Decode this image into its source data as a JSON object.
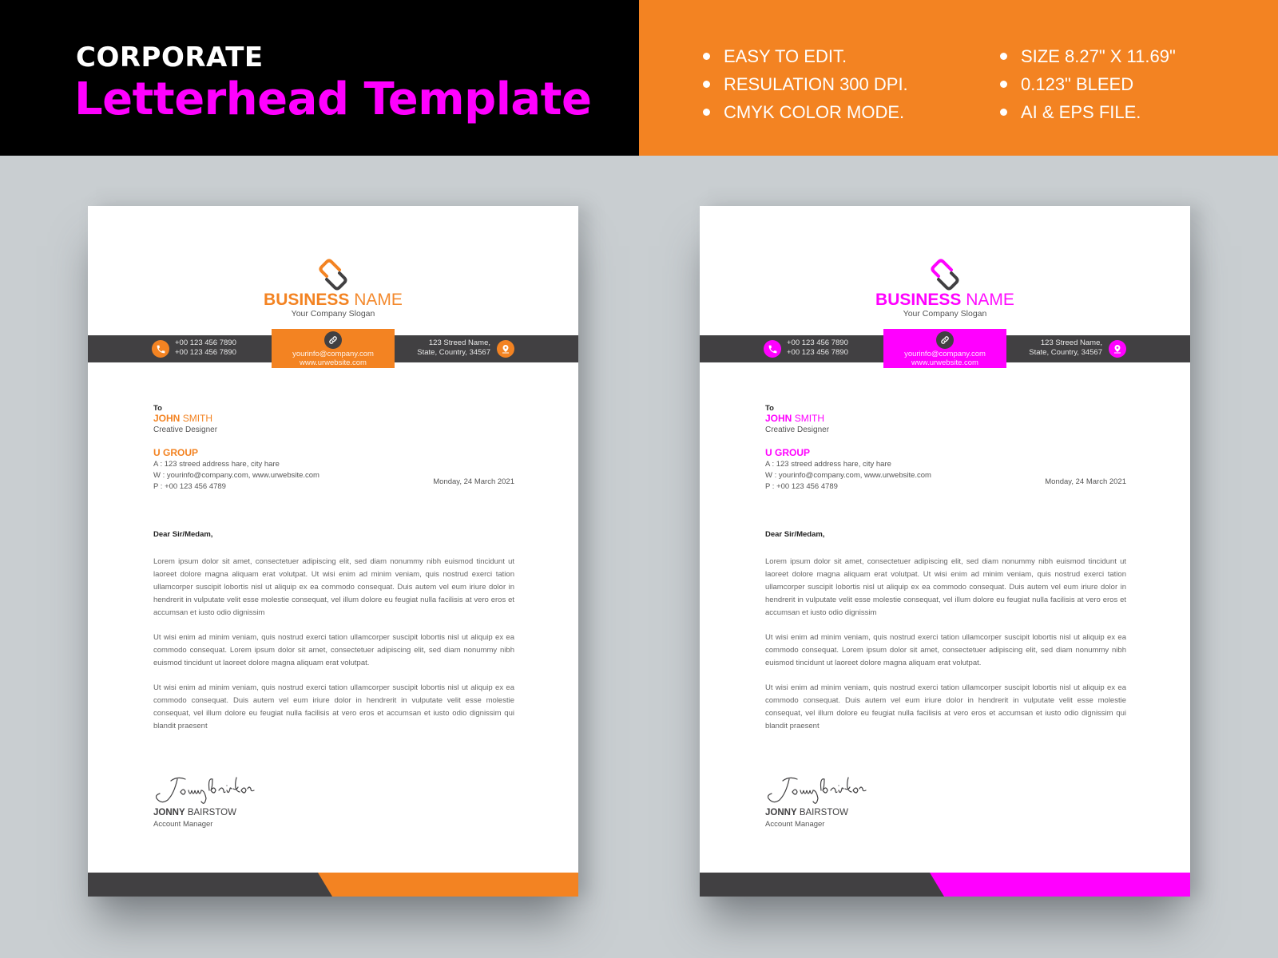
{
  "banner": {
    "title_small": "CORPORATE",
    "title_big": "Letterhead Template",
    "features_col1": [
      "EASY TO EDIT.",
      "RESULATION 300 DPI.",
      "CMYK COLOR MODE."
    ],
    "features_col2": [
      "SIZE 8.27\" X 11.69\"",
      "0.123\" BLEED",
      "AI & EPS FILE."
    ],
    "colors": {
      "left_bg": "#000000",
      "right_bg": "#f38322",
      "title_big": "#ff00ff"
    }
  },
  "letters": [
    {
      "accent": "#f38322",
      "business_bold": "BUSINESS",
      "business_light": "NAME",
      "slogan": "Your Company Slogan",
      "phone_1": "+00 123 456 7890",
      "phone_2": "+00 123 456 7890",
      "email": "yourinfo@company.com",
      "website": "www.urwebsite.com",
      "address_1": "123 Streed Name,",
      "address_2": "State, Country, 34567",
      "to_label": "To",
      "recipient_first": "JOHN",
      "recipient_last": "SMITH",
      "recipient_role": "Creative Designer",
      "company": "U GROUP",
      "company_address": "A  : 123 streed address hare, city hare",
      "company_web": "W : yourinfo@company.com, www.urwebsite.com",
      "company_phone": "P  : +00 123 456 4789",
      "date": "Monday, 24 March 2021",
      "salutation": "Dear Sir/Medam,",
      "paragraphs": [
        "Lorem ipsum dolor sit amet, consectetuer adipiscing elit, sed diam nonummy nibh euismod tincidunt ut laoreet dolore magna aliquam erat volutpat. Ut wisi enim ad minim veniam, quis nostrud exerci tation ullamcorper suscipit lobortis nisl ut aliquip ex ea commodo consequat. Duis autem vel eum iriure dolor in hendrerit in vulputate velit esse molestie consequat, vel illum dolore eu feugiat nulla facilisis at vero eros et accumsan et iusto odio dignissim",
        "Ut wisi enim ad minim veniam, quis nostrud exerci tation ullamcorper suscipit lobortis nisl ut aliquip ex ea commodo consequat. Lorem ipsum dolor sit amet, consectetuer adipiscing elit, sed diam nonummy nibh euismod tincidunt ut laoreet dolore magna aliquam erat volutpat.",
        "Ut wisi enim ad minim veniam, quis nostrud exerci tation ullamcorper suscipit lobortis nisl ut aliquip ex ea commodo consequat. Duis autem vel eum iriure dolor in hendrerit in vulputate velit esse molestie consequat, vel illum dolore eu feugiat nulla facilisis at vero eros et accumsan et iusto odio dignissim qui blandit praesent"
      ],
      "signature": "Jonnybairyton",
      "signer_first": "JONNY",
      "signer_last": "BAIRSTOW",
      "signer_role": "Account Manager"
    },
    {
      "accent": "#ff00ff",
      "business_bold": "BUSINESS",
      "business_light": "NAME",
      "slogan": "Your Company Slogan",
      "phone_1": "+00 123 456 7890",
      "phone_2": "+00 123 456 7890",
      "email": "yourinfo@company.com",
      "website": "www.urwebsite.com",
      "address_1": "123 Streed Name,",
      "address_2": "State, Country, 34567",
      "to_label": "To",
      "recipient_first": "JOHN",
      "recipient_last": "SMITH",
      "recipient_role": "Creative Designer",
      "company": "U GROUP",
      "company_address": "A  : 123 streed address hare, city hare",
      "company_web": "W : yourinfo@company.com, www.urwebsite.com",
      "company_phone": "P  : +00 123 456 4789",
      "date": "Monday, 24 March 2021",
      "salutation": "Dear Sir/Medam,",
      "paragraphs": [
        "Lorem ipsum dolor sit amet, consectetuer adipiscing elit, sed diam nonummy nibh euismod tincidunt ut laoreet dolore magna aliquam erat volutpat. Ut wisi enim ad minim veniam, quis nostrud exerci tation ullamcorper suscipit lobortis nisl ut aliquip ex ea commodo consequat. Duis autem vel eum iriure dolor in hendrerit in vulputate velit esse molestie consequat, vel illum dolore eu feugiat nulla facilisis at vero eros et accumsan et iusto odio dignissim",
        "Ut wisi enim ad minim veniam, quis nostrud exerci tation ullamcorper suscipit lobortis nisl ut aliquip ex ea commodo consequat. Lorem ipsum dolor sit amet, consectetuer adipiscing elit, sed diam nonummy nibh euismod tincidunt ut laoreet dolore magna aliquam erat volutpat.",
        "Ut wisi enim ad minim veniam, quis nostrud exerci tation ullamcorper suscipit lobortis nisl ut aliquip ex ea commodo consequat. Duis autem vel eum iriure dolor in hendrerit in vulputate velit esse molestie consequat, vel illum dolore eu feugiat nulla facilisis at vero eros et accumsan et iusto odio dignissim qui blandit praesent"
      ],
      "signature": "Jonnybairyton",
      "signer_first": "JONNY",
      "signer_last": "BAIRSTOW",
      "signer_role": "Account Manager"
    }
  ]
}
